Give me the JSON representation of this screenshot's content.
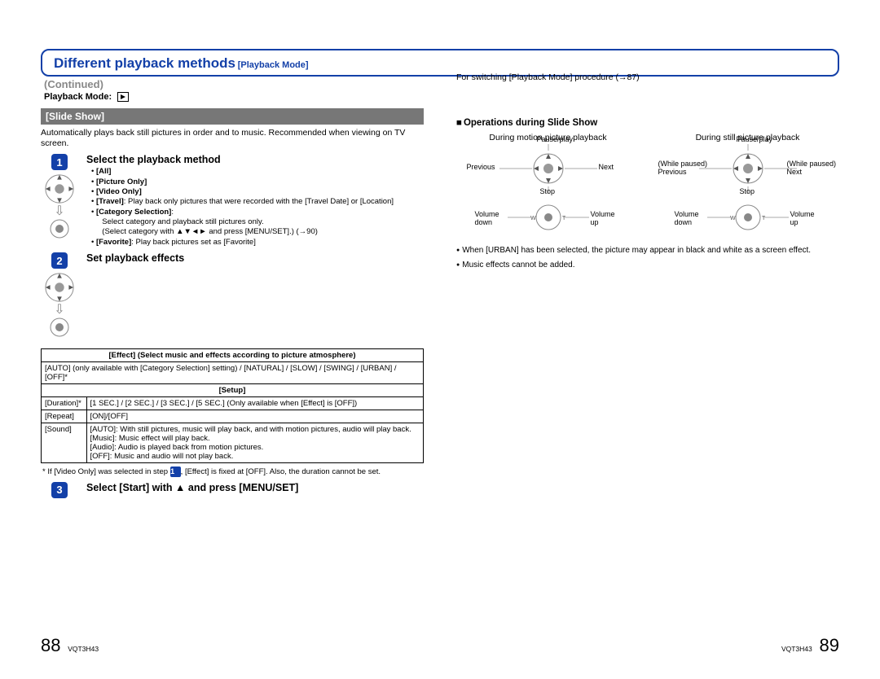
{
  "title_main": "Different playback methods",
  "title_sub": "[Playback Mode]",
  "continued": "(Continued)",
  "playback_mode_label": "Playback Mode:",
  "slide_show": {
    "header": "[Slide Show]",
    "intro": "Automatically plays back still pictures in order and to music. Recommended when viewing on TV screen."
  },
  "step1": {
    "head": "Select the playback method",
    "items": [
      "[All]",
      "[Picture Only]",
      "[Video Only]",
      "[Travel]: Play back only pictures that were recorded with the [Travel Date] or [Location]",
      "[Category Selection]:\nSelect category and playback still pictures only.\n(Select category with ▲▼◄► and press [MENU/SET].) (→90)",
      "[Favorite]: Play back pictures set as [Favorite]"
    ]
  },
  "step2": {
    "head": "Set playback effects"
  },
  "effects_table": {
    "header": "[Effect] (Select music and effects according to picture atmosphere)",
    "row1": "[AUTO] (only available with [Category Selection] setting) / [NATURAL] / [SLOW] / [SWING] / [URBAN] / [OFF]*",
    "setup_header": "[Setup]",
    "rows": [
      {
        "k": "[Duration]*",
        "v": "[1 SEC.] / [2 SEC.] / [3 SEC.] / [5 SEC.] (Only available when [Effect] is [OFF])"
      },
      {
        "k": "[Repeat]",
        "v": "[ON]/[OFF]"
      },
      {
        "k": "[Sound]",
        "v": "[AUTO]: With still pictures, music will play back, and with motion pictures, audio will play back.\n[Music]: Music effect will play back.\n[Audio]: Audio is played back from motion pictures.\n[OFF]: Music and audio will not play back."
      }
    ]
  },
  "footnote": "* If [Video Only] was selected in step    , [Effect] is fixed at [OFF]. Also, the duration cannot be set.",
  "step3": {
    "head": "Select [Start] with ▲ and press [MENU/SET]"
  },
  "right": {
    "switch_note": "For switching [Playback Mode] procedure (→87)",
    "ops_head": "Operations during Slide Show",
    "motion": {
      "title": "During motion picture playback",
      "up": "Pause/play",
      "left": "Previous",
      "right": "Next",
      "down": "Stop",
      "vleft": "Volume down",
      "vright": "Volume up"
    },
    "still": {
      "title": "During still picture playback",
      "up": "Pause/play",
      "left": "(While paused) Previous",
      "right": "(While paused) Next",
      "down": "Stop",
      "vleft": "Volume down",
      "vright": "Volume up"
    },
    "notes": [
      "When [URBAN] has been selected, the picture may appear in black and white as a screen effect.",
      "Music effects cannot be added."
    ]
  },
  "footer": {
    "left_page": "88",
    "right_page": "89",
    "docid": "VQT3H43"
  }
}
